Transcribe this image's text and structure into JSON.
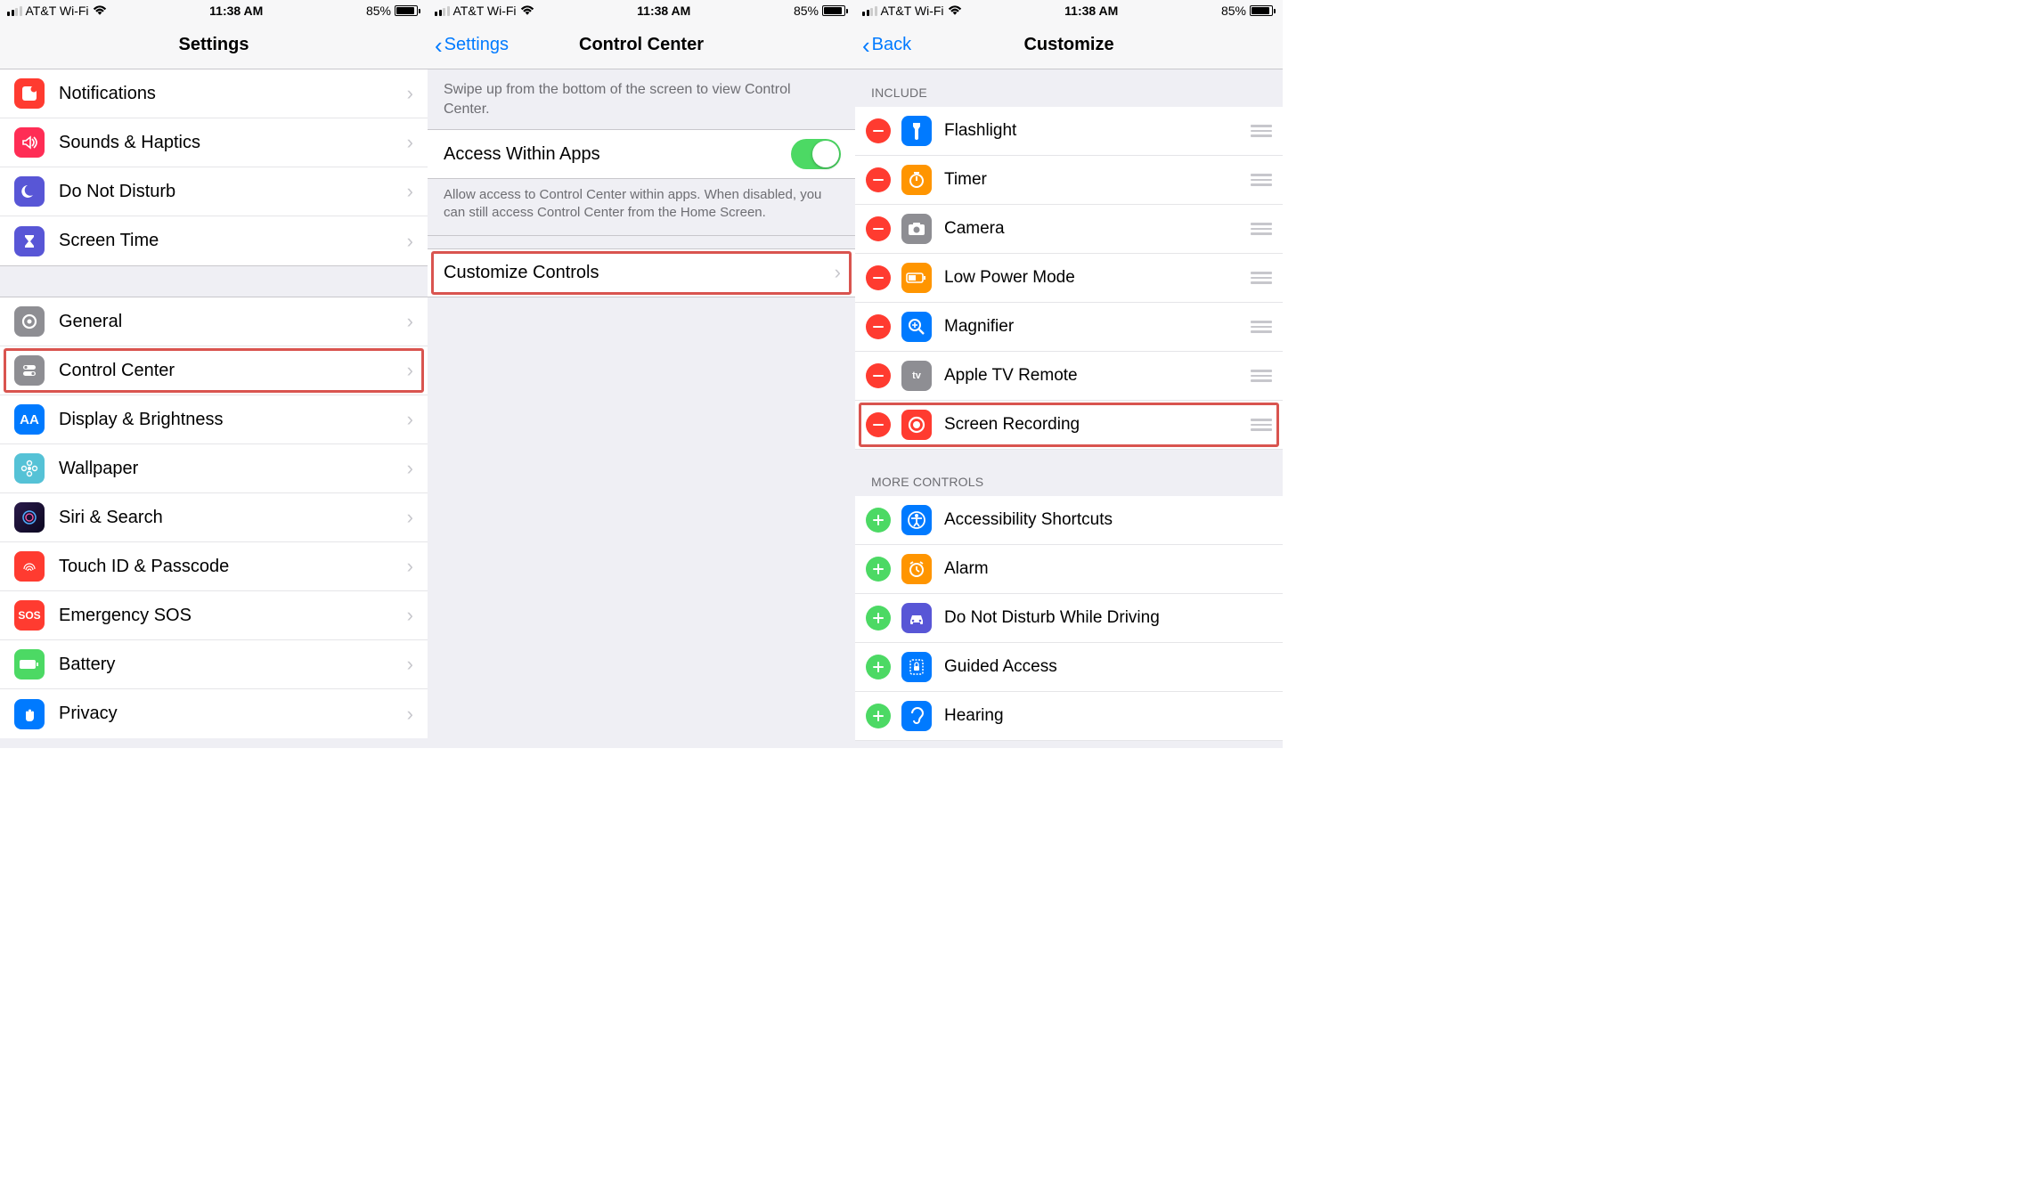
{
  "status": {
    "carrier": "AT&T Wi-Fi",
    "time": "11:38 AM",
    "battery_pct": "85%"
  },
  "screen1": {
    "title": "Settings",
    "items1": [
      {
        "label": "Notifications",
        "bg": "#ff3b30"
      },
      {
        "label": "Sounds & Haptics",
        "bg": "#ff2d55"
      },
      {
        "label": "Do Not Disturb",
        "bg": "#5856d6"
      },
      {
        "label": "Screen Time",
        "bg": "#5856d6"
      }
    ],
    "items2": [
      {
        "label": "General",
        "bg": "#8e8e93"
      },
      {
        "label": "Control Center",
        "bg": "#8e8e93",
        "hl": true
      },
      {
        "label": "Display & Brightness",
        "bg": "#007aff"
      },
      {
        "label": "Wallpaper",
        "bg": "#55c2d6"
      },
      {
        "label": "Siri & Search",
        "bg": "#27173a"
      },
      {
        "label": "Touch ID & Passcode",
        "bg": "#ff3b30"
      },
      {
        "label": "Emergency SOS",
        "bg": "#ff3b30"
      },
      {
        "label": "Battery",
        "bg": "#4cd964"
      },
      {
        "label": "Privacy",
        "bg": "#007aff"
      }
    ]
  },
  "screen2": {
    "back": "Settings",
    "title": "Control Center",
    "intro": "Swipe up from the bottom of the screen to view Control Center.",
    "toggle_label": "Access Within Apps",
    "toggle_desc": "Allow access to Control Center within apps. When disabled, you can still access Control Center from the Home Screen.",
    "customize": "Customize Controls"
  },
  "screen3": {
    "back": "Back",
    "title": "Customize",
    "include_header": "INCLUDE",
    "include": [
      {
        "label": "Flashlight",
        "bg": "#007aff"
      },
      {
        "label": "Timer",
        "bg": "#ff9500"
      },
      {
        "label": "Camera",
        "bg": "#8e8e93"
      },
      {
        "label": "Low Power Mode",
        "bg": "#ff9500"
      },
      {
        "label": "Magnifier",
        "bg": "#007aff"
      },
      {
        "label": "Apple TV Remote",
        "bg": "#8e8e93"
      },
      {
        "label": "Screen Recording",
        "bg": "#ff3b30",
        "hl": true
      }
    ],
    "more_header": "MORE CONTROLS",
    "more": [
      {
        "label": "Accessibility Shortcuts",
        "bg": "#007aff"
      },
      {
        "label": "Alarm",
        "bg": "#ff9500"
      },
      {
        "label": "Do Not Disturb While Driving",
        "bg": "#5856d6"
      },
      {
        "label": "Guided Access",
        "bg": "#007aff"
      },
      {
        "label": "Hearing",
        "bg": "#007aff"
      }
    ]
  }
}
